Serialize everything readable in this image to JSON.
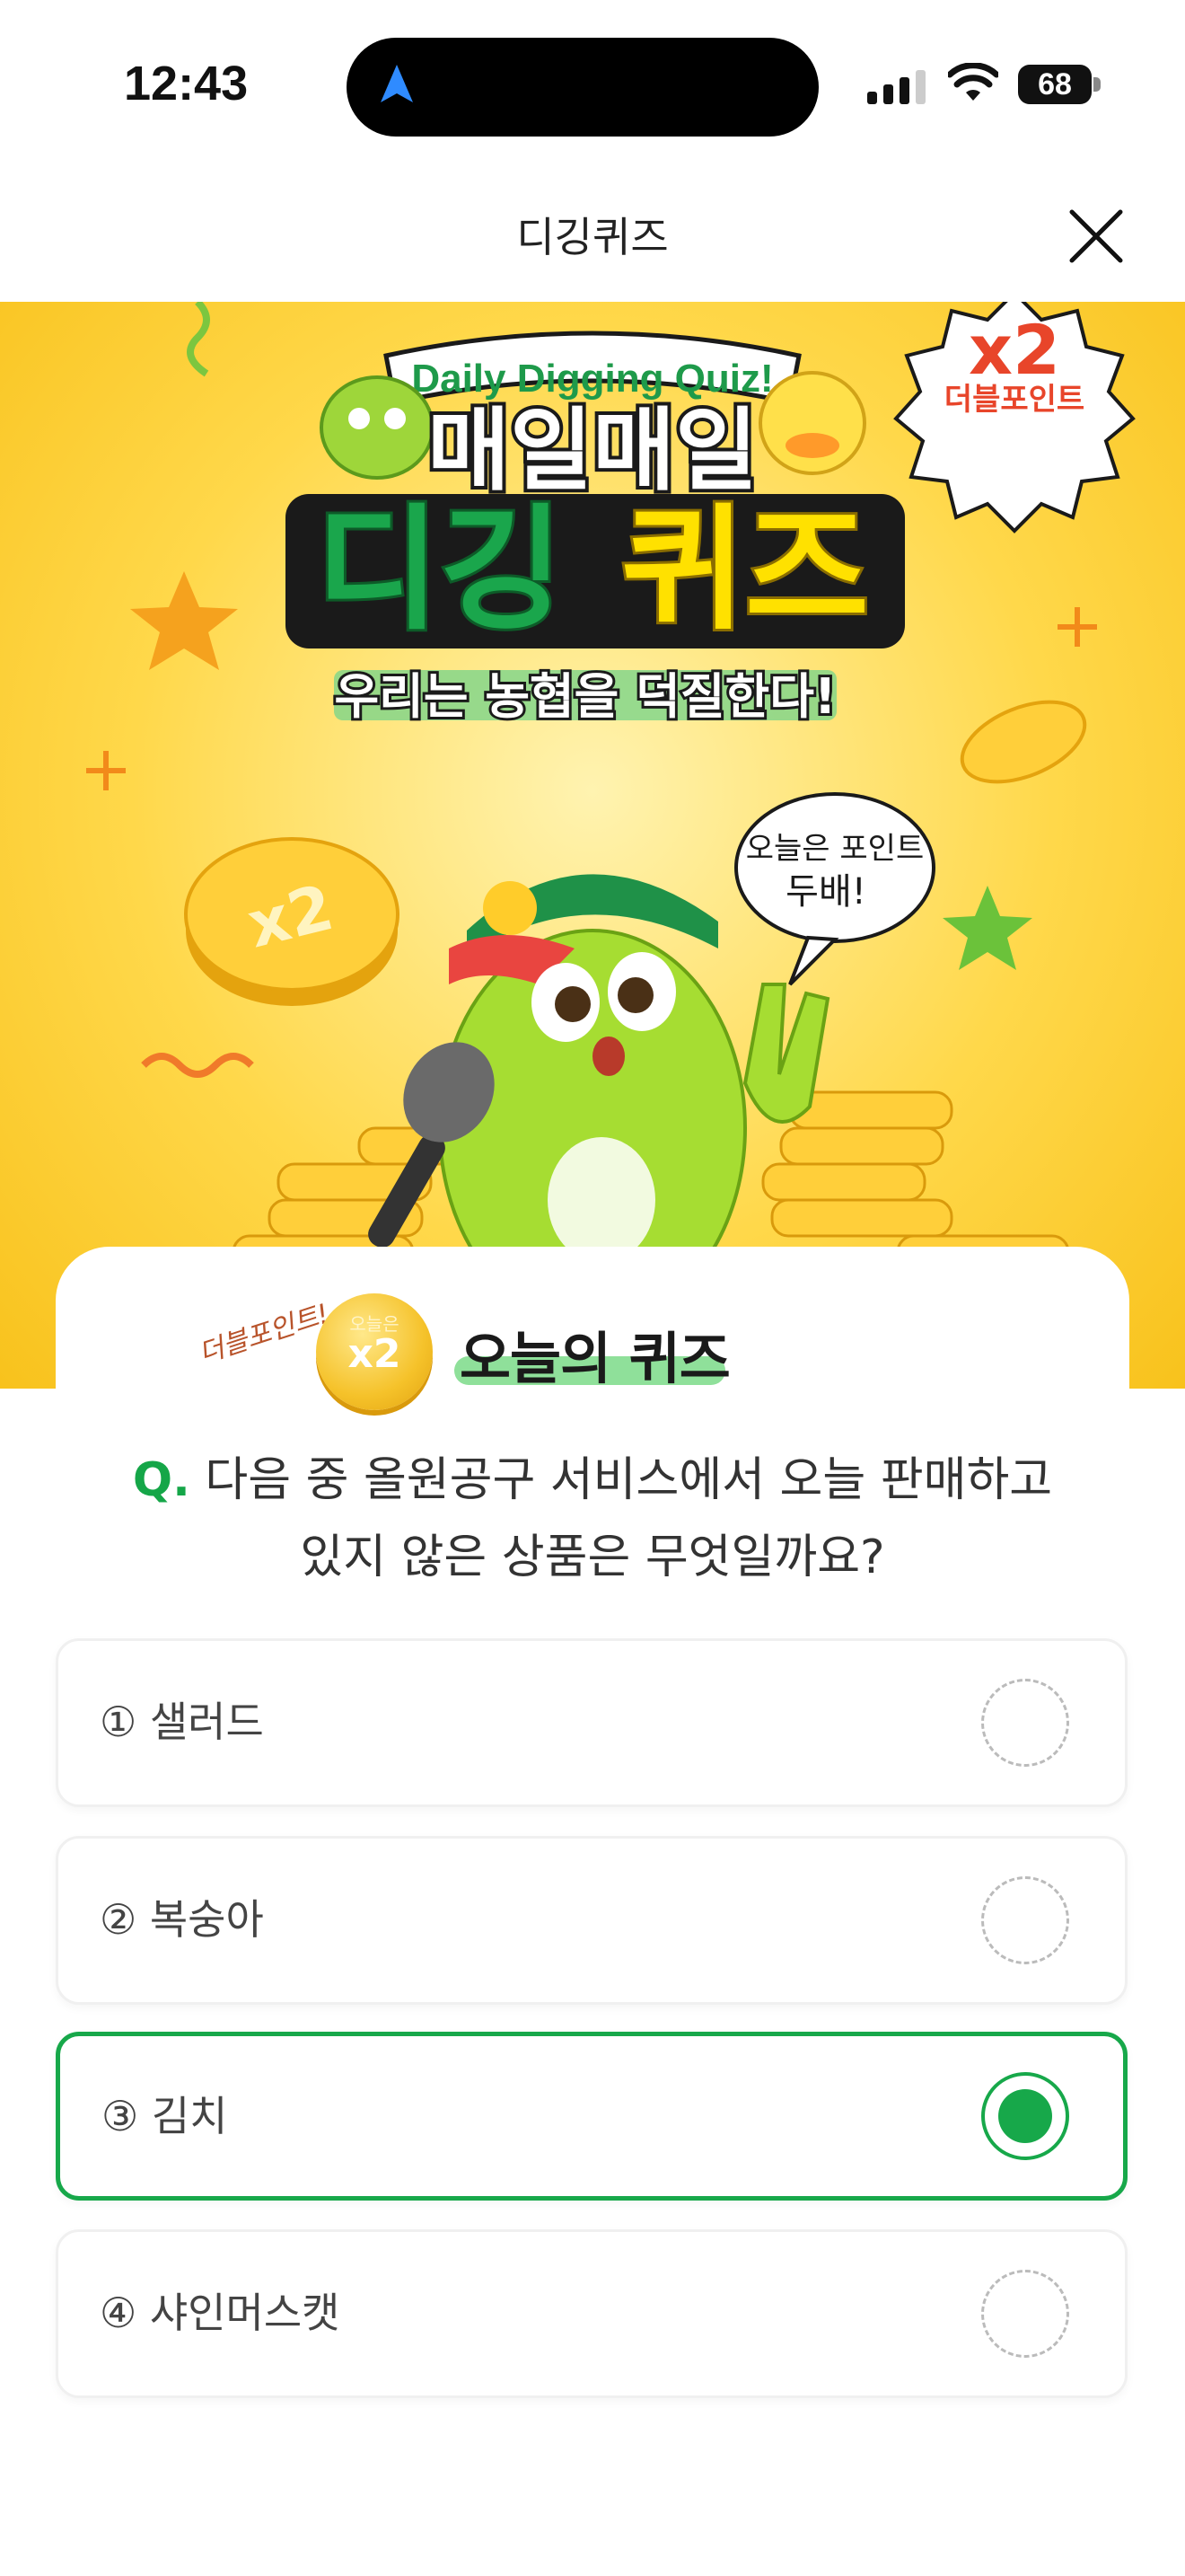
{
  "status_bar": {
    "time": "12:43",
    "battery": "68",
    "icons": [
      "navigation-arrow-icon",
      "cellular-signal-icon",
      "wifi-icon",
      "battery-icon"
    ]
  },
  "header": {
    "title": "디깅퀴즈",
    "close_icon": "close-icon"
  },
  "banner": {
    "tagline_en": "Daily Digging Quiz!",
    "title_line1": "매일매일",
    "title_line2a": "디깅",
    "title_line2b": "퀴즈",
    "subtitle": "우리는 농협을 덕질한다!",
    "badge_multiplier": "x2",
    "badge_label": "더블포인트",
    "coin_label": "x2",
    "speech_bubble_line1": "오늘은 포인트",
    "speech_bubble_line2": "두배!",
    "colors": {
      "background": "#ffd84a",
      "title_green": "#1aa64c",
      "title_yellow": "#ffe100",
      "accent_red": "#e8452a"
    }
  },
  "quiz_card": {
    "double_point_note": "더블포인트!",
    "coin_label": "오늘은",
    "coin_multiplier": "x2",
    "heading": "오늘의 퀴즈"
  },
  "question": {
    "prefix": "Q.",
    "line1": "다음 중 올원공구 서비스에서 오늘 판매하고",
    "line2": "있지 않은 상품은 무엇일까요?"
  },
  "options": [
    {
      "label": "① 샐러드",
      "selected": false
    },
    {
      "label": "② 복숭아",
      "selected": false
    },
    {
      "label": "③ 김치",
      "selected": true
    },
    {
      "label": "④ 샤인머스캣",
      "selected": false
    }
  ],
  "colors": {
    "accent": "#17a84a",
    "text": "#333333"
  }
}
